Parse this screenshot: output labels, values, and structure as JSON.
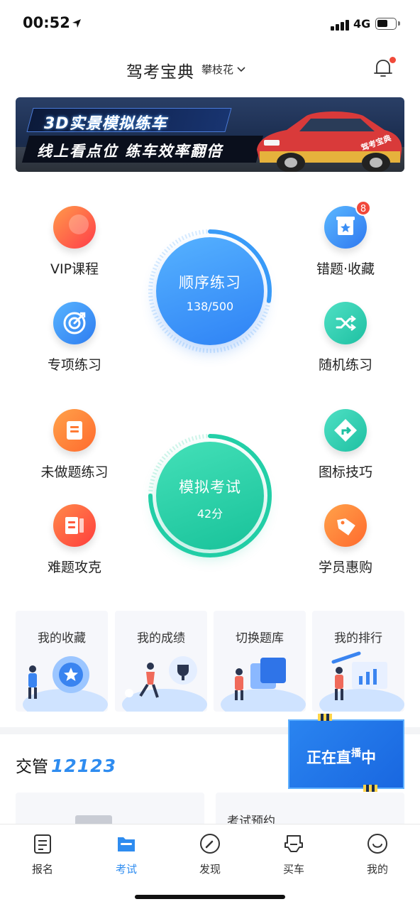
{
  "status_bar": {
    "time": "00:52",
    "network": "4G",
    "location_icon": "location-arrow-icon"
  },
  "header": {
    "title": "驾考宝典",
    "location": "攀枝花",
    "bell_icon": "bell-icon"
  },
  "banner": {
    "line1": "3D实景模拟练车",
    "line2": "线上看点位 练车效率翻倍",
    "car_label": "驾考宝典"
  },
  "practice": {
    "left_top": {
      "label": "VIP课程",
      "icon": "vip-icon"
    },
    "right_top": {
      "label": "错题·收藏",
      "icon": "star-bookmark-icon",
      "badge": "8"
    },
    "left_mid": {
      "label": "专项练习",
      "icon": "target-icon"
    },
    "right_mid": {
      "label": "随机练习",
      "icon": "shuffle-icon"
    },
    "center": {
      "title": "顺序练习",
      "progress_text": "138/500",
      "progress": 0.276
    }
  },
  "exam": {
    "left_top": {
      "label": "未做题练习",
      "icon": "notebook-icon"
    },
    "right_top": {
      "label": "图标技巧",
      "icon": "road-sign-icon"
    },
    "left_bottom": {
      "label": "难题攻克",
      "icon": "book-icon"
    },
    "right_bottom": {
      "label": "学员惠购",
      "icon": "price-tag-icon"
    },
    "center": {
      "title": "模拟考试",
      "score_text": "42分"
    }
  },
  "quick_cards": [
    {
      "label": "我的收藏"
    },
    {
      "label": "我的成绩"
    },
    {
      "label": "切换题库"
    },
    {
      "label": "我的排行"
    }
  ],
  "section": {
    "title": "交管",
    "number": "12123"
  },
  "cards": {
    "exam_booking": "考试预约"
  },
  "live": {
    "text_a": "正在直",
    "text_b": "播",
    "text_c": "中"
  },
  "tabbar": [
    {
      "label": "报名",
      "icon": "document-icon"
    },
    {
      "label": "考试",
      "icon": "folder-icon",
      "active": true
    },
    {
      "label": "发现",
      "icon": "compass-icon"
    },
    {
      "label": "买车",
      "icon": "car-icon"
    },
    {
      "label": "我的",
      "icon": "smile-icon"
    }
  ],
  "colors": {
    "accent": "#2e8cf0",
    "practice_blue": "#3a9cf8",
    "exam_green": "#24d0a8",
    "badge_red": "#f1483b"
  }
}
